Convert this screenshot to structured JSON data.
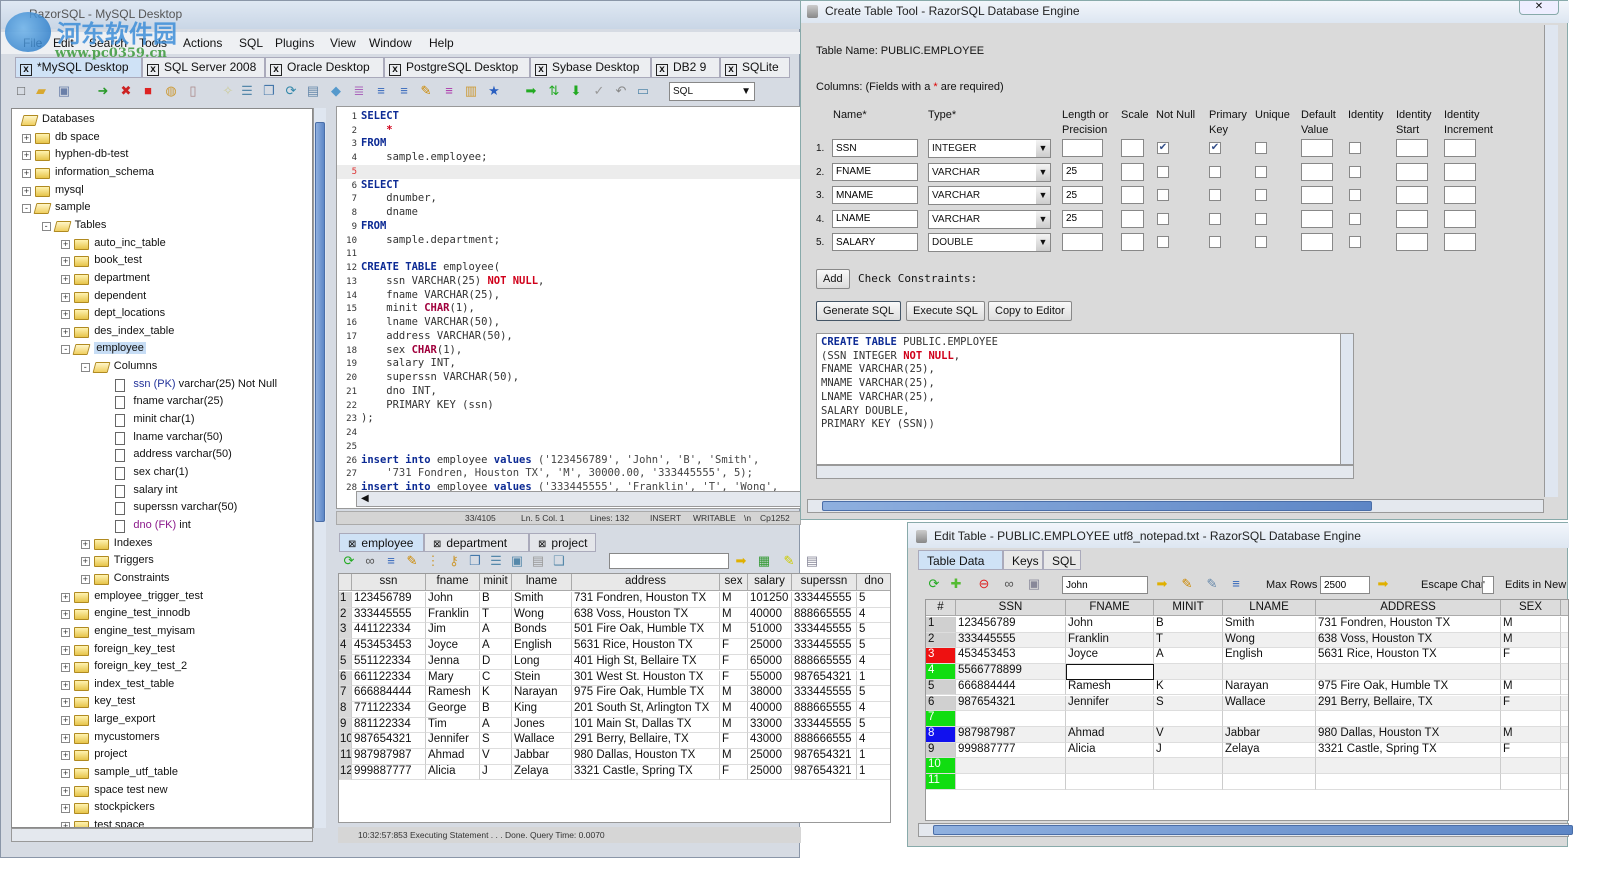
{
  "main_window": {
    "title": "RazorSQL - MySQL Desktop",
    "menu": [
      "File",
      "Edit",
      "Search",
      "Tools",
      "Actions",
      "SQL",
      "Plugins",
      "View",
      "Window",
      "Help"
    ],
    "connection_tabs": [
      "*MySQL Desktop",
      "SQL Server 2008",
      "Oracle Desktop",
      "PostgreSQL Desktop",
      "Sybase Desktop",
      "DB2 9",
      "SQLite"
    ],
    "toolbar_icons": [
      "new-file",
      "open-folder",
      "save",
      "connect",
      "disconnect",
      "close-connections",
      "db-info",
      "cylinder",
      "wand",
      "list",
      "copy",
      "refresh",
      "document",
      "tag",
      "stack",
      "align",
      "align-2",
      "edit",
      "align-3",
      "chart",
      "star",
      "arrow-right",
      "swap",
      "arrow-down",
      "check",
      "undo",
      "page"
    ],
    "sql_type_select": "SQL",
    "tree": [
      {
        "lvl": 0,
        "exp": "",
        "icon": "open",
        "label": "Databases"
      },
      {
        "lvl": 1,
        "exp": "+",
        "icon": "closed",
        "label": "db space"
      },
      {
        "lvl": 1,
        "exp": "+",
        "icon": "closed",
        "label": "hyphen-db-test"
      },
      {
        "lvl": 1,
        "exp": "+",
        "icon": "closed",
        "label": "information_schema"
      },
      {
        "lvl": 1,
        "exp": "+",
        "icon": "closed",
        "label": "mysql"
      },
      {
        "lvl": 1,
        "exp": "-",
        "icon": "open",
        "label": "sample"
      },
      {
        "lvl": 2,
        "exp": "-",
        "icon": "open",
        "label": "Tables"
      },
      {
        "lvl": 3,
        "exp": "+",
        "icon": "closed",
        "label": "auto_inc_table"
      },
      {
        "lvl": 3,
        "exp": "+",
        "icon": "closed",
        "label": "book_test"
      },
      {
        "lvl": 3,
        "exp": "+",
        "icon": "closed",
        "label": "department"
      },
      {
        "lvl": 3,
        "exp": "+",
        "icon": "closed",
        "label": "dependent"
      },
      {
        "lvl": 3,
        "exp": "+",
        "icon": "closed",
        "label": "dept_locations"
      },
      {
        "lvl": 3,
        "exp": "+",
        "icon": "closed",
        "label": "des_index_table"
      },
      {
        "lvl": 3,
        "exp": "-",
        "icon": "open",
        "label": "employee",
        "selected": true
      },
      {
        "lvl": 4,
        "exp": "-",
        "icon": "open",
        "label": "Columns"
      },
      {
        "lvl": 5,
        "exp": "",
        "icon": "file",
        "key": "ssn (PK)",
        "keytype": "pk",
        "label": " varchar(25) Not Null"
      },
      {
        "lvl": 5,
        "exp": "",
        "icon": "file",
        "label": "fname varchar(25)"
      },
      {
        "lvl": 5,
        "exp": "",
        "icon": "file",
        "label": "minit char(1)"
      },
      {
        "lvl": 5,
        "exp": "",
        "icon": "file",
        "label": "lname varchar(50)"
      },
      {
        "lvl": 5,
        "exp": "",
        "icon": "file",
        "label": "address varchar(50)"
      },
      {
        "lvl": 5,
        "exp": "",
        "icon": "file",
        "label": "sex char(1)"
      },
      {
        "lvl": 5,
        "exp": "",
        "icon": "file",
        "label": "salary int"
      },
      {
        "lvl": 5,
        "exp": "",
        "icon": "file",
        "label": "superssn varchar(50)"
      },
      {
        "lvl": 5,
        "exp": "",
        "icon": "file",
        "key": "dno (FK)",
        "keytype": "fk",
        "label": " int"
      },
      {
        "lvl": 4,
        "exp": "+",
        "icon": "closed",
        "label": "Indexes"
      },
      {
        "lvl": 4,
        "exp": "+",
        "icon": "closed",
        "label": "Triggers"
      },
      {
        "lvl": 4,
        "exp": "+",
        "icon": "closed",
        "label": "Constraints"
      },
      {
        "lvl": 3,
        "exp": "+",
        "icon": "closed",
        "label": "employee_trigger_test"
      },
      {
        "lvl": 3,
        "exp": "+",
        "icon": "closed",
        "label": "engine_test_innodb"
      },
      {
        "lvl": 3,
        "exp": "+",
        "icon": "closed",
        "label": "engine_test_myisam"
      },
      {
        "lvl": 3,
        "exp": "+",
        "icon": "closed",
        "label": "foreign_key_test"
      },
      {
        "lvl": 3,
        "exp": "+",
        "icon": "closed",
        "label": "foreign_key_test_2"
      },
      {
        "lvl": 3,
        "exp": "+",
        "icon": "closed",
        "label": "index_test_table"
      },
      {
        "lvl": 3,
        "exp": "+",
        "icon": "closed",
        "label": "key_test"
      },
      {
        "lvl": 3,
        "exp": "+",
        "icon": "closed",
        "label": "large_export"
      },
      {
        "lvl": 3,
        "exp": "+",
        "icon": "closed",
        "label": "mycustomers"
      },
      {
        "lvl": 3,
        "exp": "+",
        "icon": "closed",
        "label": "project"
      },
      {
        "lvl": 3,
        "exp": "+",
        "icon": "closed",
        "label": "sample_utf_table"
      },
      {
        "lvl": 3,
        "exp": "+",
        "icon": "closed",
        "label": "space test new"
      },
      {
        "lvl": 3,
        "exp": "+",
        "icon": "closed",
        "label": "stockpickers"
      },
      {
        "lvl": 3,
        "exp": "+",
        "icon": "closed",
        "label": "test space"
      }
    ],
    "editor_lines": [
      [
        [
          "kw",
          "SELECT"
        ]
      ],
      [
        [
          "red",
          "    *"
        ]
      ],
      [
        [
          "kw",
          "FROM"
        ]
      ],
      [
        [
          "tx",
          "    sample.employee;"
        ]
      ],
      [],
      [
        [
          "kw",
          "SELECT"
        ]
      ],
      [
        [
          "tx",
          "    dnumber,"
        ]
      ],
      [
        [
          "tx",
          "    dname"
        ]
      ],
      [
        [
          "kw",
          "FROM"
        ]
      ],
      [
        [
          "tx",
          "    sample.department;"
        ]
      ],
      [],
      [
        [
          "kw",
          "CREATE TABLE"
        ],
        [
          "tx",
          " employee("
        ]
      ],
      [
        [
          "tx",
          "    ssn VARCHAR(25) "
        ],
        [
          "red",
          "NOT NULL"
        ],
        [
          "tx",
          ","
        ]
      ],
      [
        [
          "tx",
          "    fname VARCHAR(25),"
        ]
      ],
      [
        [
          "tx",
          "    minit "
        ],
        [
          "ty",
          "CHAR"
        ],
        [
          "tx",
          "(1),"
        ]
      ],
      [
        [
          "tx",
          "    lname VARCHAR(50),"
        ]
      ],
      [
        [
          "tx",
          "    address VARCHAR(50),"
        ]
      ],
      [
        [
          "tx",
          "    sex "
        ],
        [
          "ty",
          "CHAR"
        ],
        [
          "tx",
          "(1),"
        ]
      ],
      [
        [
          "tx",
          "    salary INT,"
        ]
      ],
      [
        [
          "tx",
          "    superssn VARCHAR(50),"
        ]
      ],
      [
        [
          "tx",
          "    dno INT,"
        ]
      ],
      [
        [
          "tx",
          "    PRIMARY KEY (ssn)"
        ]
      ],
      [
        [
          "tx",
          ");"
        ]
      ],
      [],
      [],
      [
        [
          "kw",
          "insert into"
        ],
        [
          "tx",
          " employee "
        ],
        [
          "kw",
          "values"
        ],
        [
          "str",
          " ('123456789', 'John', 'B', 'Smith',"
        ]
      ],
      [
        [
          "str",
          "    '731 Fondren, Houston TX', 'M', 30000.00, '333445555', 5);"
        ]
      ],
      [
        [
          "kw",
          "insert into"
        ],
        [
          "tx",
          " employee "
        ],
        [
          "kw",
          "values"
        ],
        [
          "str",
          " ('333445555', 'Franklin', 'T', 'Wong',"
        ]
      ]
    ],
    "current_line": 5,
    "editor_status": [
      "33/4105",
      "Ln. 5 Col. 1",
      "Lines: 132",
      "INSERT",
      "WRITABLE",
      "\\n",
      "Cp1252"
    ],
    "result_tabs": [
      "employee",
      "department",
      "project"
    ],
    "result_columns": [
      "ssn",
      "fname",
      "minit",
      "lname",
      "address",
      "sex",
      "salary",
      "superssn",
      "dno"
    ],
    "result_rows": [
      [
        "123456789",
        "John",
        "B",
        "Smith",
        "731 Fondren, Houston TX",
        "M",
        "101250",
        "333445555",
        "5"
      ],
      [
        "333445555",
        "Franklin",
        "T",
        "Wong",
        "638 Voss, Houston TX",
        "M",
        "40000",
        "888665555",
        "4"
      ],
      [
        "441122334",
        "Jim",
        "A",
        "Bonds",
        "501 Fire Oak, Humble TX",
        "M",
        "51000",
        "333445555",
        "5"
      ],
      [
        "453453453",
        "Joyce",
        "A",
        "English",
        "5631 Rice, Houston TX",
        "F",
        "25000",
        "333445555",
        "5"
      ],
      [
        "551122334",
        "Jenna",
        "D",
        "Long",
        "401 High St, Bellaire TX",
        "F",
        "65000",
        "888665555",
        "4"
      ],
      [
        "661122334",
        "Mary",
        "C",
        "Stein",
        "301 West St. Houston TX",
        "F",
        "55000",
        "987654321",
        "1"
      ],
      [
        "666884444",
        "Ramesh",
        "K",
        "Narayan",
        "975 Fire Oak, Humble TX",
        "M",
        "38000",
        "333445555",
        "5"
      ],
      [
        "771122334",
        "George",
        "B",
        "King",
        "201 South St, Arlington TX",
        "M",
        "40000",
        "888665555",
        "4"
      ],
      [
        "881122334",
        "Tim",
        "A",
        "Jones",
        "101 Main St, Dallas TX",
        "M",
        "33000",
        "333445555",
        "5"
      ],
      [
        "987654321",
        "Jennifer",
        "S",
        "Wallace",
        "291 Berry, Bellaire, TX",
        "F",
        "43000",
        "888666555",
        "4"
      ],
      [
        "987987987",
        "Ahmad",
        "V",
        "Jabbar",
        "980 Dallas, Houston TX",
        "M",
        "25000",
        "987654321",
        "1"
      ],
      [
        "999887777",
        "Alicia",
        "J",
        "Zelaya",
        "3321 Castle, Spring TX",
        "F",
        "25000",
        "987654321",
        "1"
      ]
    ],
    "status_text": "10:32:57:853 Executing Statement . . . Done. Query Time: 0.0070"
  },
  "create_table": {
    "title": "Create Table Tool - RazorSQL Database Engine",
    "table_name": "Table Name: PUBLIC.EMPLOYEE",
    "columns_note_pre": "Columns: (Fields with a ",
    "columns_note_star": "*",
    "columns_note_post": " are required)",
    "headers": [
      "Name*",
      "Type*",
      "Length or Precision",
      "Scale",
      "Not Null",
      "Primary Key",
      "Unique",
      "Default Value",
      "Identity",
      "Identity Start",
      "Identity Increment"
    ],
    "rows": [
      {
        "num": "1.",
        "name": "SSN",
        "type": "INTEGER",
        "length": "",
        "not_null": true,
        "pk": true
      },
      {
        "num": "2.",
        "name": "FNAME",
        "type": "VARCHAR",
        "length": "25",
        "not_null": false,
        "pk": false
      },
      {
        "num": "3.",
        "name": "MNAME",
        "type": "VARCHAR",
        "length": "25",
        "not_null": false,
        "pk": false
      },
      {
        "num": "4.",
        "name": "LNAME",
        "type": "VARCHAR",
        "length": "25",
        "not_null": false,
        "pk": false
      },
      {
        "num": "5.",
        "name": "SALARY",
        "type": "DOUBLE",
        "length": "",
        "not_null": false,
        "pk": false
      }
    ],
    "add_label": "Add",
    "check_constraints_label": "Check Constraints:",
    "generate_sql": "Generate SQL",
    "execute_sql": "Execute SQL",
    "copy_to_editor": "Copy to Editor",
    "sql_lines": [
      [
        [
          "kw",
          "CREATE TABLE"
        ],
        [
          "tx",
          " PUBLIC.EMPLOYEE"
        ]
      ],
      [
        [
          "tx",
          "(SSN INTEGER "
        ],
        [
          "red",
          "NOT NULL"
        ],
        [
          "tx",
          ","
        ]
      ],
      [
        [
          "tx",
          "FNAME VARCHAR(25),"
        ]
      ],
      [
        [
          "tx",
          "MNAME VARCHAR(25),"
        ]
      ],
      [
        [
          "tx",
          "LNAME VARCHAR(25),"
        ]
      ],
      [
        [
          "tx",
          "SALARY DOUBLE,"
        ]
      ],
      [
        [
          "tx",
          "PRIMARY KEY (SSN))"
        ]
      ]
    ]
  },
  "edit_table": {
    "title": "Edit Table - PUBLIC.EMPLOYEE utf8_notepad.txt - RazorSQL Database Engine",
    "tabs": [
      "Table Data",
      "Keys",
      "SQL"
    ],
    "filter_value": "John",
    "max_rows_label": "Max Rows",
    "max_rows_value": "2500",
    "escape_char_label": "Escape Char",
    "escape_char_value": "'",
    "edits_label": "Edits in New",
    "columns": [
      "#",
      "SSN",
      "FNAME",
      "MINIT",
      "LNAME",
      "ADDRESS",
      "SEX"
    ],
    "rows": [
      {
        "n": "1",
        "state": "normal",
        "cells": [
          "123456789",
          "John",
          "B",
          "Smith",
          "731 Fondren, Houston TX",
          "M"
        ]
      },
      {
        "n": "2",
        "state": "normal",
        "cells": [
          "333445555",
          "Franklin",
          "T",
          "Wong",
          "638 Voss, Houston TX",
          "M"
        ]
      },
      {
        "n": "3",
        "state": "deleted",
        "cells": [
          "453453453",
          "Joyce",
          "A",
          "English",
          "5631 Rice, Houston TX",
          "F"
        ]
      },
      {
        "n": "4",
        "state": "new",
        "cells": [
          "5566778899",
          "",
          "",
          "",
          "",
          ""
        ]
      },
      {
        "n": "5",
        "state": "normal",
        "cells": [
          "666884444",
          "Ramesh",
          "K",
          "Narayan",
          "975 Fire Oak, Humble TX",
          "M"
        ]
      },
      {
        "n": "6",
        "state": "normal",
        "cells": [
          "987654321",
          "Jennifer",
          "S",
          "Wallace",
          "291 Berry, Bellaire, TX",
          "F"
        ]
      },
      {
        "n": "7",
        "state": "new",
        "cells": [
          "",
          "",
          "",
          "",
          "",
          ""
        ]
      },
      {
        "n": "8",
        "state": "edited",
        "cells": [
          "987987987",
          "Ahmad",
          "V",
          "Jabbar",
          "980 Dallas, Houston TX",
          "M"
        ]
      },
      {
        "n": "9",
        "state": "normal",
        "cells": [
          "999887777",
          "Alicia",
          "J",
          "Zelaya",
          "3321 Castle, Spring TX",
          "F"
        ]
      },
      {
        "n": "10",
        "state": "new",
        "cells": [
          "",
          "",
          "",
          "",
          "",
          ""
        ]
      },
      {
        "n": "11",
        "state": "new",
        "cells": [
          "",
          "",
          "",
          "",
          "",
          ""
        ]
      }
    ],
    "state_colors": {
      "normal": "#d0d0d0",
      "deleted": "#ee1111",
      "new": "#11dd11",
      "edited": "#1111ee"
    }
  },
  "watermark": {
    "name": "河东软件园",
    "url": "www.pc0359.cn"
  }
}
